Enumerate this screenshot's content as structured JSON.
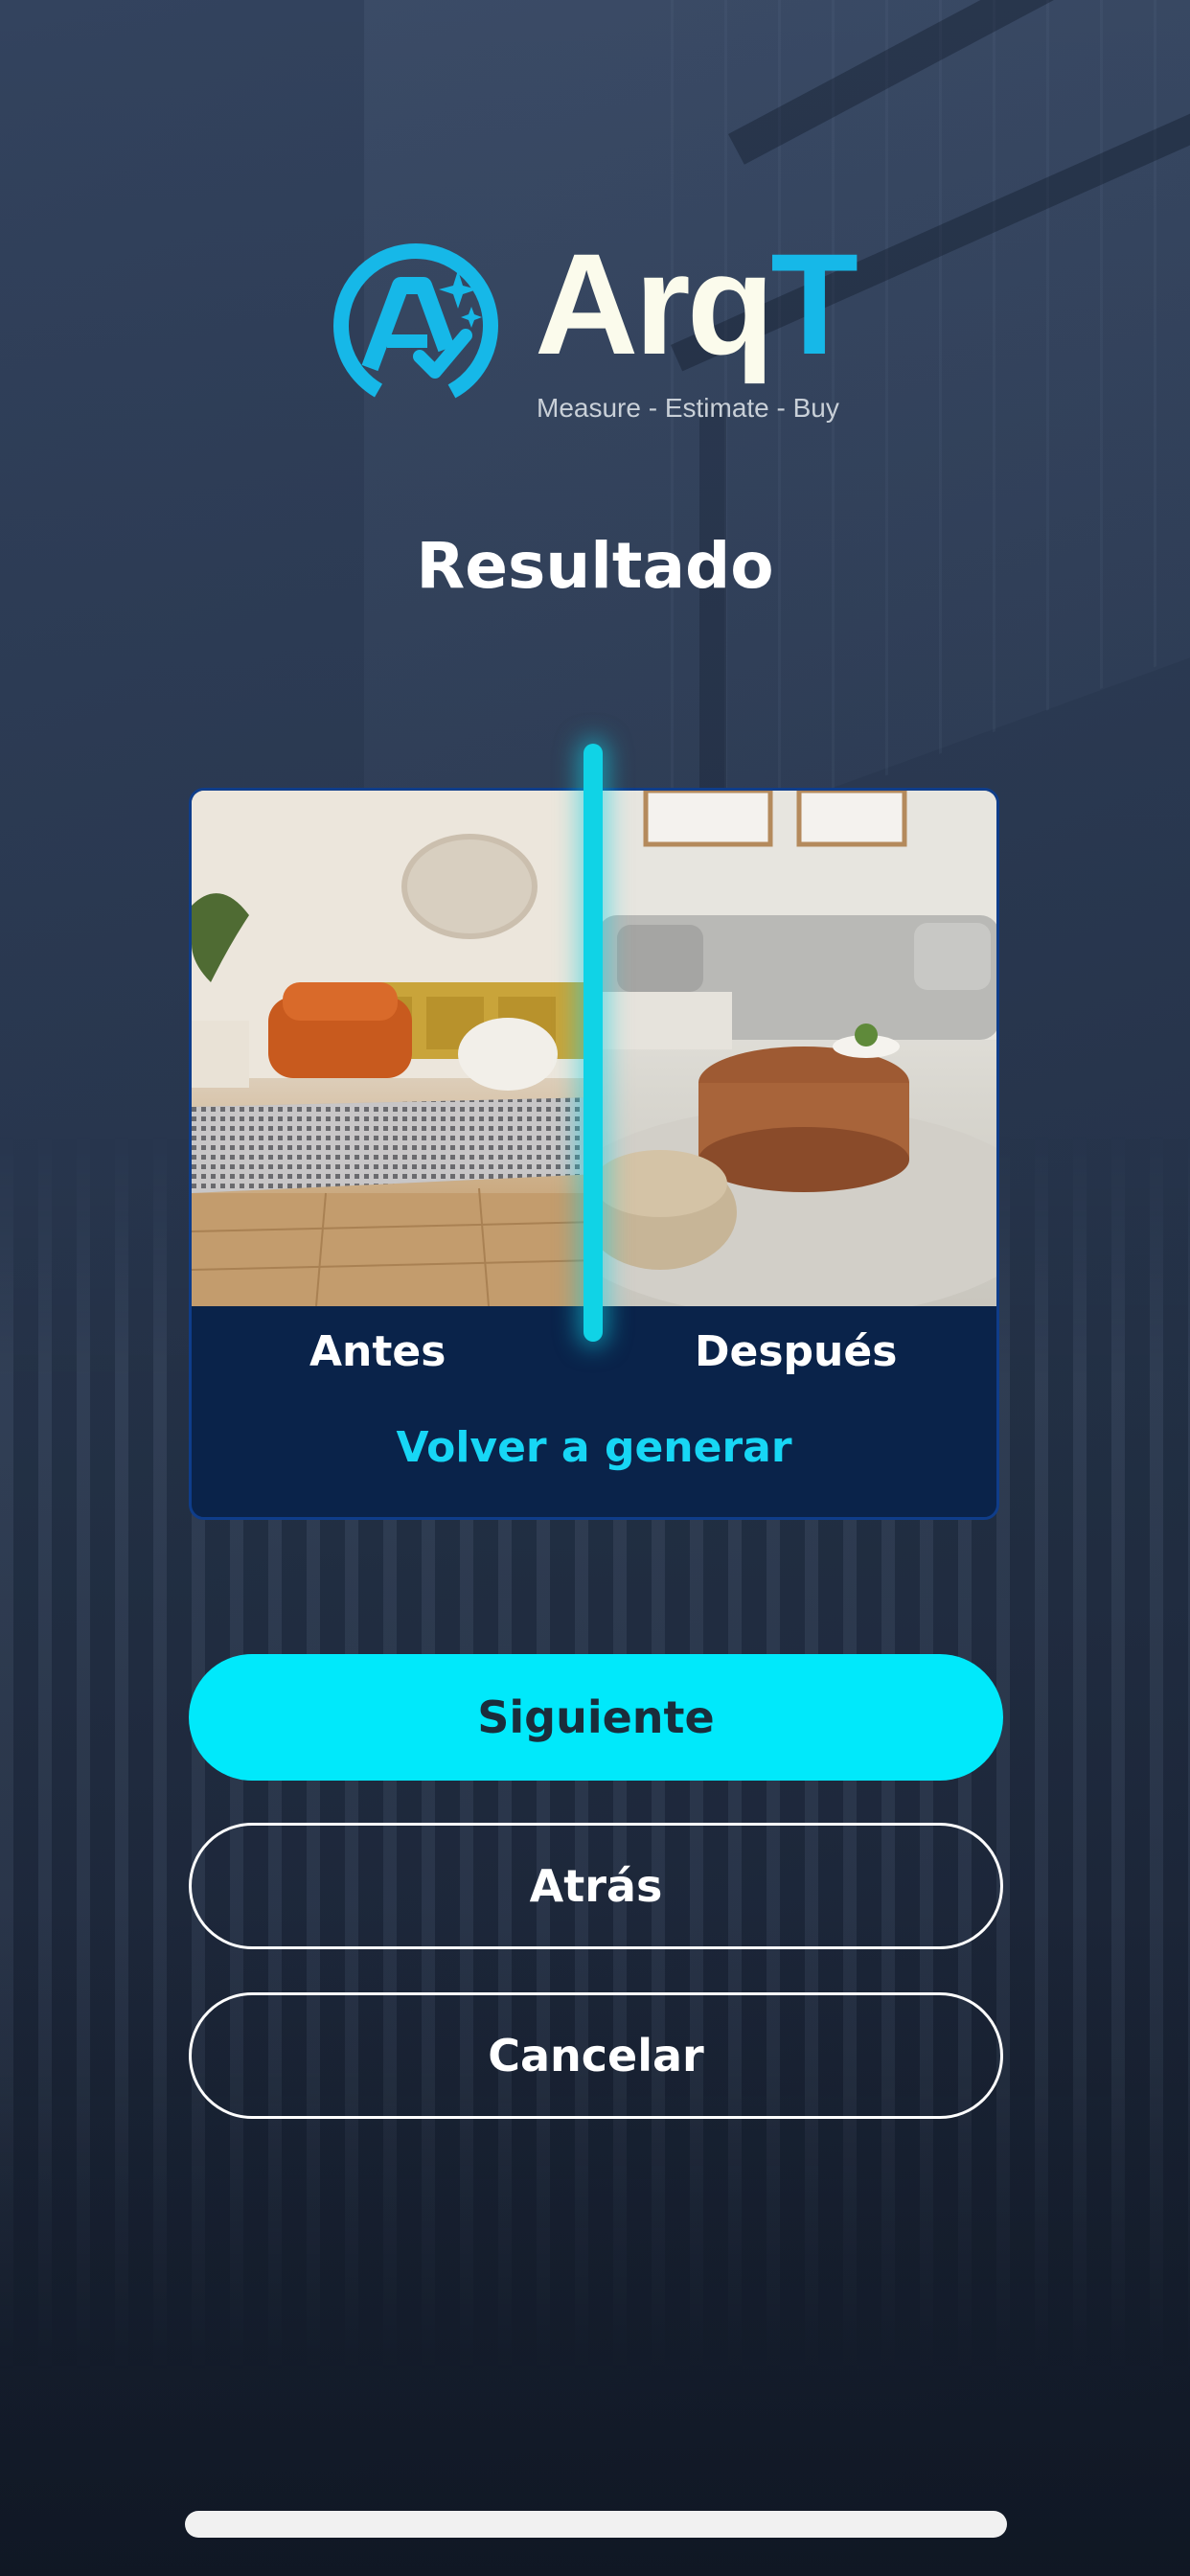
{
  "brand": {
    "name_main": "Arq",
    "name_accent": "T",
    "tagline": "Measure - Estimate - Buy",
    "colors": {
      "wordmark": "#fbfbec",
      "accent": "#16b8e8"
    }
  },
  "page": {
    "title": "Resultado"
  },
  "comparison": {
    "before_label": "Antes",
    "after_label": "Después",
    "regenerate_label": "Volver a generar"
  },
  "actions": {
    "next_label": "Siguiente",
    "back_label": "Atrás",
    "cancel_label": "Cancelar"
  },
  "colors": {
    "primary": "#00e9fb",
    "card": "#0a234a",
    "link": "#17d6f5"
  }
}
